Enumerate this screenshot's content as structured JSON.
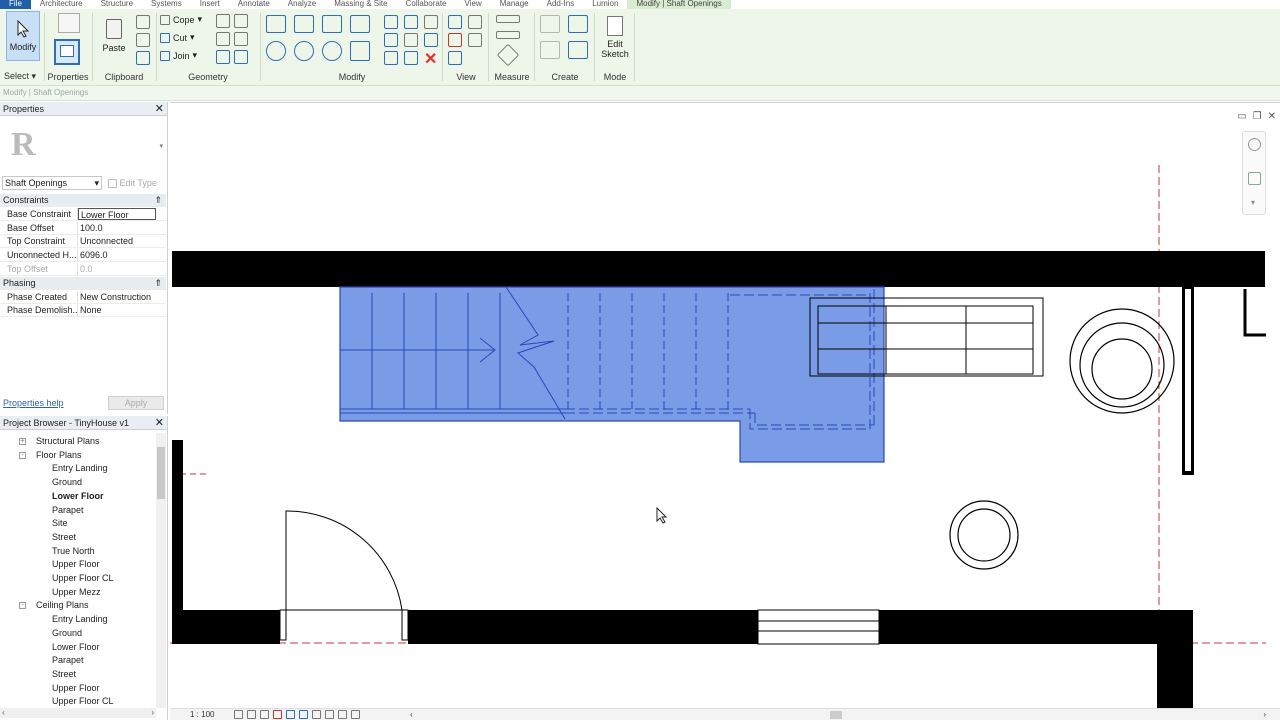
{
  "menu_tabs": [
    "File",
    "Architecture",
    "Structure",
    "Systems",
    "Insert",
    "Annotate",
    "Analyze",
    "Massing & Site",
    "Collaborate",
    "View",
    "Manage",
    "Add-Ins",
    "Lumion",
    "Modify | Shaft Openings"
  ],
  "ribbon": {
    "select": {
      "modify_label": "Modify",
      "panel_label": "Select"
    },
    "properties": {
      "panel_label": "Properties"
    },
    "clipboard": {
      "paste_label": "Paste",
      "panel_label": "Clipboard"
    },
    "geometry": {
      "cope_label": "Cope",
      "cut_label": "Cut",
      "join_label": "Join",
      "panel_label": "Geometry"
    },
    "modify": {
      "panel_label": "Modify"
    },
    "view": {
      "panel_label": "View"
    },
    "measure": {
      "panel_label": "Measure"
    },
    "create": {
      "panel_label": "Create"
    },
    "mode": {
      "edit_label": "Edit",
      "sketch_label": "Sketch",
      "panel_label": "Mode"
    }
  },
  "options_bar": "Modify | Shaft Openings",
  "properties": {
    "title": "Properties",
    "type_name": "Shaft Openings",
    "edit_type": "Edit Type",
    "sections": [
      {
        "name": "Constraints",
        "rows": [
          {
            "key": "Base Constraint",
            "value": "Lower Floor",
            "disabled": false
          },
          {
            "key": "Base Offset",
            "value": "100.0",
            "disabled": false
          },
          {
            "key": "Top Constraint",
            "value": "Unconnected",
            "disabled": false
          },
          {
            "key": "Unconnected H...",
            "value": "6096.0",
            "disabled": false
          },
          {
            "key": "Top Offset",
            "value": "0.0",
            "disabled": true
          }
        ]
      },
      {
        "name": "Phasing",
        "rows": [
          {
            "key": "Phase Created",
            "value": "New Construction",
            "disabled": false
          },
          {
            "key": "Phase Demolish...",
            "value": "None",
            "disabled": false
          }
        ]
      }
    ],
    "help_link": "Properties help",
    "apply_label": "Apply"
  },
  "browser": {
    "title": "Project Browser - TinyHouse v1",
    "items": [
      {
        "label": "Structural Plans",
        "level": 1,
        "expander": "+",
        "bold": false
      },
      {
        "label": "Floor Plans",
        "level": 1,
        "expander": "-",
        "bold": false
      },
      {
        "label": "Entry Landing",
        "level": 2,
        "bold": false
      },
      {
        "label": "Ground",
        "level": 2,
        "bold": false
      },
      {
        "label": "Lower Floor",
        "level": 2,
        "bold": true
      },
      {
        "label": "Parapet",
        "level": 2,
        "bold": false
      },
      {
        "label": "Site",
        "level": 2,
        "bold": false
      },
      {
        "label": "Street",
        "level": 2,
        "bold": false
      },
      {
        "label": "True North",
        "level": 2,
        "bold": false
      },
      {
        "label": "Upper Floor",
        "level": 2,
        "bold": false
      },
      {
        "label": "Upper Floor CL",
        "level": 2,
        "bold": false
      },
      {
        "label": "Upper Mezz",
        "level": 2,
        "bold": false
      },
      {
        "label": "Ceiling Plans",
        "level": 1,
        "expander": "-",
        "bold": false
      },
      {
        "label": "Entry Landing",
        "level": 2,
        "bold": false
      },
      {
        "label": "Ground",
        "level": 2,
        "bold": false
      },
      {
        "label": "Lower Floor",
        "level": 2,
        "bold": false
      },
      {
        "label": "Parapet",
        "level": 2,
        "bold": false
      },
      {
        "label": "Street",
        "level": 2,
        "bold": false
      },
      {
        "label": "Upper Floor",
        "level": 2,
        "bold": false
      },
      {
        "label": "Upper Floor CL",
        "level": 2,
        "bold": false
      }
    ]
  },
  "view_control": {
    "scale": "1 : 100"
  },
  "colors": {
    "selection": "#7a9be6",
    "selection_edge": "#2a48b8",
    "wall": "#000000",
    "ribbon_bg": "#eef6e9",
    "file_tab": "#1f5fa8"
  }
}
